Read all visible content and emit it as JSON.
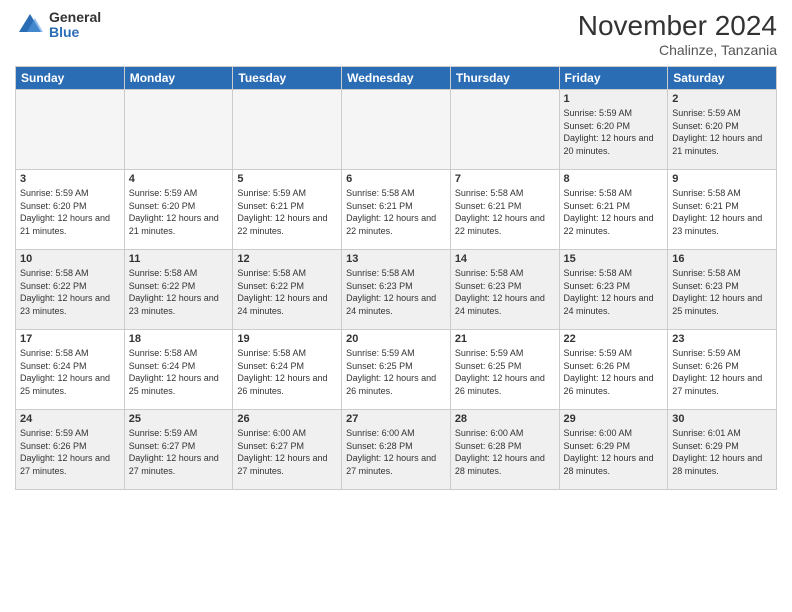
{
  "header": {
    "logo_general": "General",
    "logo_blue": "Blue",
    "month_title": "November 2024",
    "location": "Chalinze, Tanzania"
  },
  "days_of_week": [
    "Sunday",
    "Monday",
    "Tuesday",
    "Wednesday",
    "Thursday",
    "Friday",
    "Saturday"
  ],
  "weeks": [
    [
      {
        "day": "",
        "info": ""
      },
      {
        "day": "",
        "info": ""
      },
      {
        "day": "",
        "info": ""
      },
      {
        "day": "",
        "info": ""
      },
      {
        "day": "",
        "info": ""
      },
      {
        "day": "1",
        "info": "Sunrise: 5:59 AM\nSunset: 6:20 PM\nDaylight: 12 hours and 20 minutes."
      },
      {
        "day": "2",
        "info": "Sunrise: 5:59 AM\nSunset: 6:20 PM\nDaylight: 12 hours and 21 minutes."
      }
    ],
    [
      {
        "day": "3",
        "info": "Sunrise: 5:59 AM\nSunset: 6:20 PM\nDaylight: 12 hours and 21 minutes."
      },
      {
        "day": "4",
        "info": "Sunrise: 5:59 AM\nSunset: 6:20 PM\nDaylight: 12 hours and 21 minutes."
      },
      {
        "day": "5",
        "info": "Sunrise: 5:59 AM\nSunset: 6:21 PM\nDaylight: 12 hours and 22 minutes."
      },
      {
        "day": "6",
        "info": "Sunrise: 5:58 AM\nSunset: 6:21 PM\nDaylight: 12 hours and 22 minutes."
      },
      {
        "day": "7",
        "info": "Sunrise: 5:58 AM\nSunset: 6:21 PM\nDaylight: 12 hours and 22 minutes."
      },
      {
        "day": "8",
        "info": "Sunrise: 5:58 AM\nSunset: 6:21 PM\nDaylight: 12 hours and 22 minutes."
      },
      {
        "day": "9",
        "info": "Sunrise: 5:58 AM\nSunset: 6:21 PM\nDaylight: 12 hours and 23 minutes."
      }
    ],
    [
      {
        "day": "10",
        "info": "Sunrise: 5:58 AM\nSunset: 6:22 PM\nDaylight: 12 hours and 23 minutes."
      },
      {
        "day": "11",
        "info": "Sunrise: 5:58 AM\nSunset: 6:22 PM\nDaylight: 12 hours and 23 minutes."
      },
      {
        "day": "12",
        "info": "Sunrise: 5:58 AM\nSunset: 6:22 PM\nDaylight: 12 hours and 24 minutes."
      },
      {
        "day": "13",
        "info": "Sunrise: 5:58 AM\nSunset: 6:23 PM\nDaylight: 12 hours and 24 minutes."
      },
      {
        "day": "14",
        "info": "Sunrise: 5:58 AM\nSunset: 6:23 PM\nDaylight: 12 hours and 24 minutes."
      },
      {
        "day": "15",
        "info": "Sunrise: 5:58 AM\nSunset: 6:23 PM\nDaylight: 12 hours and 24 minutes."
      },
      {
        "day": "16",
        "info": "Sunrise: 5:58 AM\nSunset: 6:23 PM\nDaylight: 12 hours and 25 minutes."
      }
    ],
    [
      {
        "day": "17",
        "info": "Sunrise: 5:58 AM\nSunset: 6:24 PM\nDaylight: 12 hours and 25 minutes."
      },
      {
        "day": "18",
        "info": "Sunrise: 5:58 AM\nSunset: 6:24 PM\nDaylight: 12 hours and 25 minutes."
      },
      {
        "day": "19",
        "info": "Sunrise: 5:58 AM\nSunset: 6:24 PM\nDaylight: 12 hours and 26 minutes."
      },
      {
        "day": "20",
        "info": "Sunrise: 5:59 AM\nSunset: 6:25 PM\nDaylight: 12 hours and 26 minutes."
      },
      {
        "day": "21",
        "info": "Sunrise: 5:59 AM\nSunset: 6:25 PM\nDaylight: 12 hours and 26 minutes."
      },
      {
        "day": "22",
        "info": "Sunrise: 5:59 AM\nSunset: 6:26 PM\nDaylight: 12 hours and 26 minutes."
      },
      {
        "day": "23",
        "info": "Sunrise: 5:59 AM\nSunset: 6:26 PM\nDaylight: 12 hours and 27 minutes."
      }
    ],
    [
      {
        "day": "24",
        "info": "Sunrise: 5:59 AM\nSunset: 6:26 PM\nDaylight: 12 hours and 27 minutes."
      },
      {
        "day": "25",
        "info": "Sunrise: 5:59 AM\nSunset: 6:27 PM\nDaylight: 12 hours and 27 minutes."
      },
      {
        "day": "26",
        "info": "Sunrise: 6:00 AM\nSunset: 6:27 PM\nDaylight: 12 hours and 27 minutes."
      },
      {
        "day": "27",
        "info": "Sunrise: 6:00 AM\nSunset: 6:28 PM\nDaylight: 12 hours and 27 minutes."
      },
      {
        "day": "28",
        "info": "Sunrise: 6:00 AM\nSunset: 6:28 PM\nDaylight: 12 hours and 28 minutes."
      },
      {
        "day": "29",
        "info": "Sunrise: 6:00 AM\nSunset: 6:29 PM\nDaylight: 12 hours and 28 minutes."
      },
      {
        "day": "30",
        "info": "Sunrise: 6:01 AM\nSunset: 6:29 PM\nDaylight: 12 hours and 28 minutes."
      }
    ]
  ]
}
